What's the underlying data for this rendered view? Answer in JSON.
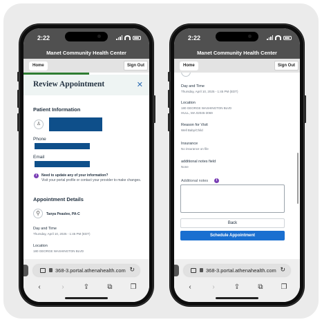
{
  "status": {
    "time": "2:22"
  },
  "app": {
    "header_title": "Manet Community Health Center",
    "home_label": "Home",
    "signout_label": "Sign Out"
  },
  "left": {
    "review_title": "Review Appointment",
    "close_glyph": "✕",
    "patient_info_title": "Patient Information",
    "phone_label": "Phone",
    "email_label": "Email",
    "notice_bold": "Need to update any of your information?",
    "notice_text": "Visit your portal profile or contact your provider to make changes.",
    "appt_details_title": "Appointment Details",
    "provider_name": "Tanya Peaslee, PA-C",
    "day_time_label": "Day and Time",
    "day_time_value": "Thursday, April 10, 2025 - 1:45 PM (EDT)",
    "location_label": "Location",
    "location_line1": "180 GEORGE WASHINGTON BLVD"
  },
  "right": {
    "day_time_label": "Day and Time",
    "day_time_value": "Thursday, April 10, 2025 - 1:45 PM (EDT)",
    "location_label": "Location",
    "location_line1": "180 GEORGE WASHINGTON BLVD",
    "location_line2": "HULL, MA 02045-3069",
    "reason_label": "Reason for Visit",
    "reason_value": "Well Baby/Child",
    "insurance_label": "Insurance",
    "insurance_value": "No insurance on file",
    "notes_field_label": "additional notes field",
    "notes_field_value": "None",
    "additional_notes_label": "Additional notes",
    "back_label": "Back",
    "schedule_label": "Schedule Appointment"
  },
  "browser": {
    "url": "368-3.portal.athenahealth.com"
  },
  "colors": {
    "accent": "#1a6fd0",
    "redaction": "#0e4f8a",
    "progress": "#2e7d32",
    "header": "#505050"
  },
  "icons": [
    "user-icon",
    "info-icon",
    "stethoscope-icon",
    "close-icon",
    "lock-icon",
    "reload-icon",
    "back-icon",
    "forward-icon",
    "share-icon",
    "bookmarks-icon",
    "tabs-icon"
  ]
}
